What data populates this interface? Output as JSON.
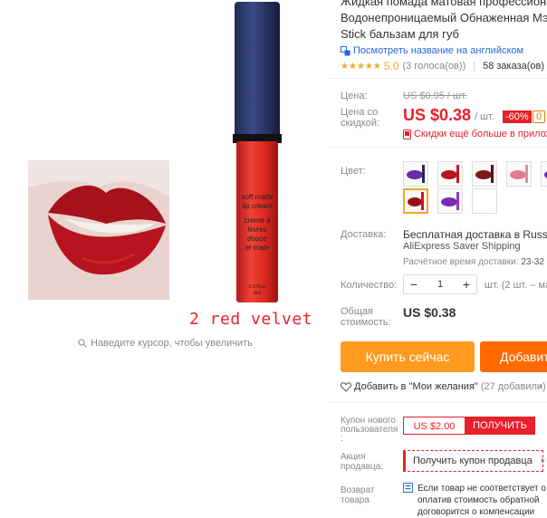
{
  "gallery": {
    "caption": "2 red velvet",
    "zoom_hint": "Наведите курсор, чтобы увеличить",
    "tube_text": [
      "soft matte",
      "lip cream",
      "creme à",
      "lèvres",
      "douce",
      "et mate"
    ],
    "tube_volume": "0.27fl.oz",
    "tube_volume_2": "8ml"
  },
  "product": {
    "title_line1": "Жидкая помада матовая профессиональ",
    "title_line2": "Водонепроницаемый Обнаженная Мэт",
    "title_line3": "Stick бальзам для губ",
    "translate_link": "Посмотреть название на английском",
    "stars": "★★★★★",
    "rating": "5.0",
    "rating_count": "(3 голоса(ов))",
    "rating_sep": "|",
    "orders": "58 заказа(ов)"
  },
  "price": {
    "label": "Цена:",
    "old": "US $0.95 / шт.",
    "sale_label_1": "Цена со",
    "sale_label_2": "скидкой:",
    "sale": "US $0.38",
    "unit": "/ шт.",
    "discount": "-60%",
    "extra_badge": "0",
    "more_discounts": "Скидки ещё больше в прилож"
  },
  "color": {
    "label": "Цвет:",
    "selected_index": 5
  },
  "delivery": {
    "label": "Доставка:",
    "line1": "Бесплатная доставка в Russian F",
    "line2": "AliExpress Saver Shipping",
    "line3_prefix": "Расчётное время доставки:",
    "line3_value": "23-32"
  },
  "quantity": {
    "label": "Количество:",
    "minus": "−",
    "value": "1",
    "plus": "+",
    "unit": "шт. (2 шт. – мак"
  },
  "total": {
    "label_1": "Общая",
    "label_2": "стоимость:",
    "value": "US $0.38"
  },
  "actions": {
    "buy_now": "Купить сейчас",
    "add_to_cart": "Добавит"
  },
  "wishlist": {
    "label": "Добавить в \"Мои желания\"",
    "count": "(27 добавили)",
    "arrow": "›"
  },
  "coupon": {
    "label_1": "Купон нового",
    "label_2": "пользователя",
    "label_3": ":",
    "amount": "US $2.00",
    "get": "ПОЛУЧИТЬ"
  },
  "promo": {
    "label_1": "Акция",
    "label_2": "продавца:",
    "select": "Получить купон продавца",
    "chevron": "▾",
    "arrow": "›"
  },
  "returns": {
    "label_1": "Возврат",
    "label_2": "товара",
    "line1": "Если товар не соответствует о",
    "line2": "оплатив стоимость обратной",
    "line3": "договорится о компенсации"
  },
  "colors": {
    "accent_red": "#e8202b",
    "buy_orange": "#ff9a1f",
    "cart_orange": "#ff6a00",
    "star_yellow": "#f6a623",
    "link_blue": "#2568d8"
  }
}
